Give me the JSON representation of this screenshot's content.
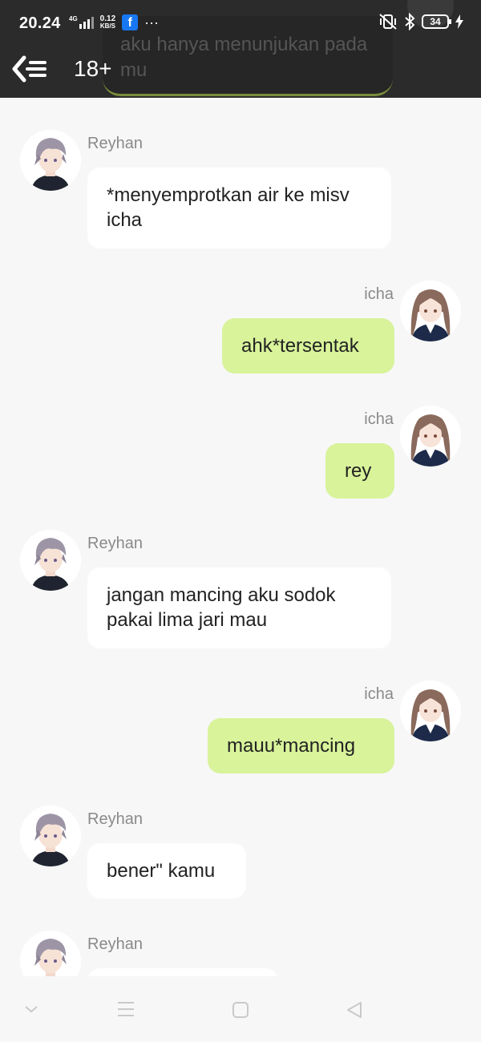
{
  "status_bar": {
    "time": "20.24",
    "network_label": "4G",
    "speed_value": "0.12",
    "speed_unit": "KB/S",
    "facebook_letter": "f",
    "more": "···",
    "battery": "34"
  },
  "header": {
    "title": "18+",
    "background": "#2b2b2b",
    "ghost_text": "aku hanya menunjukan pada mu"
  },
  "colors": {
    "incoming_bubble": "#ffffff",
    "outgoing_bubble": "#d8f39a",
    "background": "#f7f7f7"
  },
  "messages": [
    {
      "sender": "Reyhan",
      "side": "left",
      "text": "*menyemprotkan air ke misv icha"
    },
    {
      "sender": "icha",
      "side": "right",
      "text": "ahk*tersentak"
    },
    {
      "sender": "icha",
      "side": "right",
      "text": "rey"
    },
    {
      "sender": "Reyhan",
      "side": "left",
      "text": "jangan mancing aku sodok pakai lima jari mau"
    },
    {
      "sender": "icha",
      "side": "right",
      "text": "mauu*mancing"
    },
    {
      "sender": "Reyhan",
      "side": "left",
      "text": "bener\" kamu"
    },
    {
      "sender": "Reyhan",
      "side": "left",
      "text": ""
    }
  ],
  "navigation": {
    "buttons": [
      "chevron-down-icon",
      "menu-icon",
      "home-square-icon",
      "back-triangle-icon"
    ]
  }
}
